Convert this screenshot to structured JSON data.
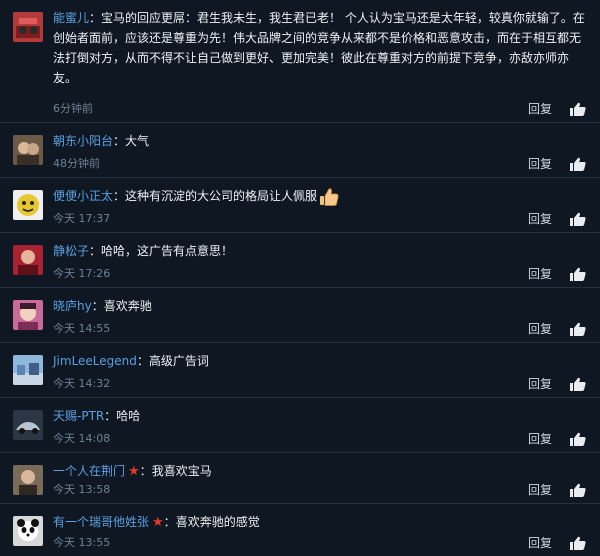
{
  "comments": [
    {
      "name": "能蜜儿",
      "text": "宝马的回应更屌：君生我未生，我生君已老！ 个人认为宝马还是太年轻，较真你就输了。在创始者面前，应该还是尊重为先！伟大品牌之间的竞争从来都不是价格和恶意攻击，而在于相互都无法打倒对方，从而不得不让自己做到更好、更加完美！彼此在尊重对方的前提下竞争，亦敌亦师亦友。",
      "time": "6分钟前",
      "reply": "回复",
      "avatar_color": "#b33a3a"
    },
    {
      "name": "朝东小阳台",
      "text": "大气",
      "time": "48分钟前",
      "reply": "回复",
      "avatar_color": "#6b5a48"
    },
    {
      "name": "便便小正太",
      "text": "这种有沉淀的大公司的格局让人佩服",
      "time": "今天 17:37",
      "reply": "回复",
      "avatar_color": "#e7c830",
      "emoji": "thumbs-up-emoji"
    },
    {
      "name": "静松子",
      "text": "哈哈，这广告有点意思！",
      "time": "今天 17:26",
      "reply": "回复",
      "avatar_color": "#a82332"
    },
    {
      "name": "晓庐hy",
      "text": "喜欢奔驰",
      "time": "今天 14:55",
      "reply": "回复",
      "avatar_color": "#c86a9a"
    },
    {
      "name": "JimLeeLegend",
      "text": "高级广告词",
      "time": "今天 14:32",
      "reply": "回复",
      "avatar_color": "#5f86b2"
    },
    {
      "name": "天赐-PTR",
      "text": "哈哈",
      "time": "今天 14:08",
      "reply": "回复",
      "avatar_color": "#2a3644"
    },
    {
      "name": "一个人在荆门",
      "text": "我喜欢宝马",
      "time": "今天 13:58",
      "reply": "回复",
      "avatar_color": "#7a6a58",
      "star": "★"
    },
    {
      "name": "有一个瑞哥他姓张",
      "text": "喜欢奔驰的感觉",
      "time": "今天 13:55",
      "reply": "回复",
      "avatar_color": "#d8d8d8",
      "star": "★"
    }
  ],
  "sep": "："
}
